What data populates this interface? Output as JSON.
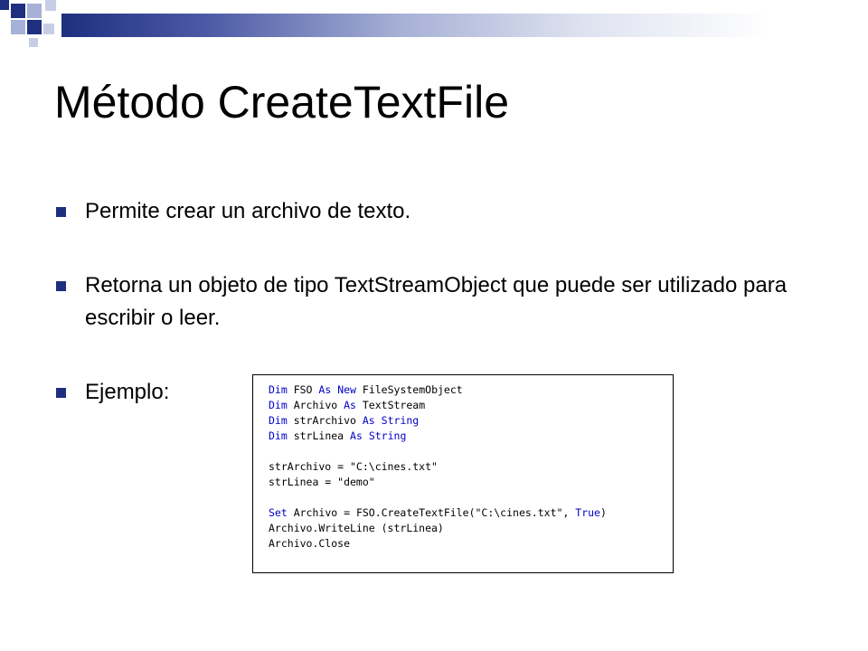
{
  "colors": {
    "accent": "#1f2f80",
    "keyword": "#0000c8"
  },
  "slide": {
    "title": "Método CreateTextFile",
    "bullets": [
      {
        "text": "Permite crear un archivo de texto."
      },
      {
        "text": "Retorna un objeto de tipo TextStreamObject que puede ser utilizado para escribir o leer."
      },
      {
        "text": "Ejemplo:"
      }
    ]
  },
  "code": {
    "lines": [
      [
        {
          "t": "Dim",
          "k": 1
        },
        {
          "t": " FSO "
        },
        {
          "t": "As",
          "k": 1
        },
        {
          "t": " "
        },
        {
          "t": "New",
          "k": 1
        },
        {
          "t": " FileSystemObject"
        }
      ],
      [
        {
          "t": "Dim",
          "k": 1
        },
        {
          "t": " Archivo "
        },
        {
          "t": "As",
          "k": 1
        },
        {
          "t": " TextStream"
        }
      ],
      [
        {
          "t": "Dim",
          "k": 1
        },
        {
          "t": " strArchivo "
        },
        {
          "t": "As",
          "k": 1
        },
        {
          "t": " "
        },
        {
          "t": "String",
          "k": 1
        }
      ],
      [
        {
          "t": "Dim",
          "k": 1
        },
        {
          "t": " strLinea "
        },
        {
          "t": "As",
          "k": 1
        },
        {
          "t": " "
        },
        {
          "t": "String",
          "k": 1
        }
      ],
      [],
      [
        {
          "t": "strArchivo = \"C:\\cines.txt\""
        }
      ],
      [
        {
          "t": "strLinea = \"demo\""
        }
      ],
      [],
      [
        {
          "t": "Set",
          "k": 1
        },
        {
          "t": " Archivo = FSO.CreateTextFile(\"C:\\cines.txt\", "
        },
        {
          "t": "True",
          "k": 1
        },
        {
          "t": ")"
        }
      ],
      [
        {
          "t": "Archivo.WriteLine (strLinea)"
        }
      ],
      [
        {
          "t": "Archivo.Close"
        }
      ]
    ]
  }
}
